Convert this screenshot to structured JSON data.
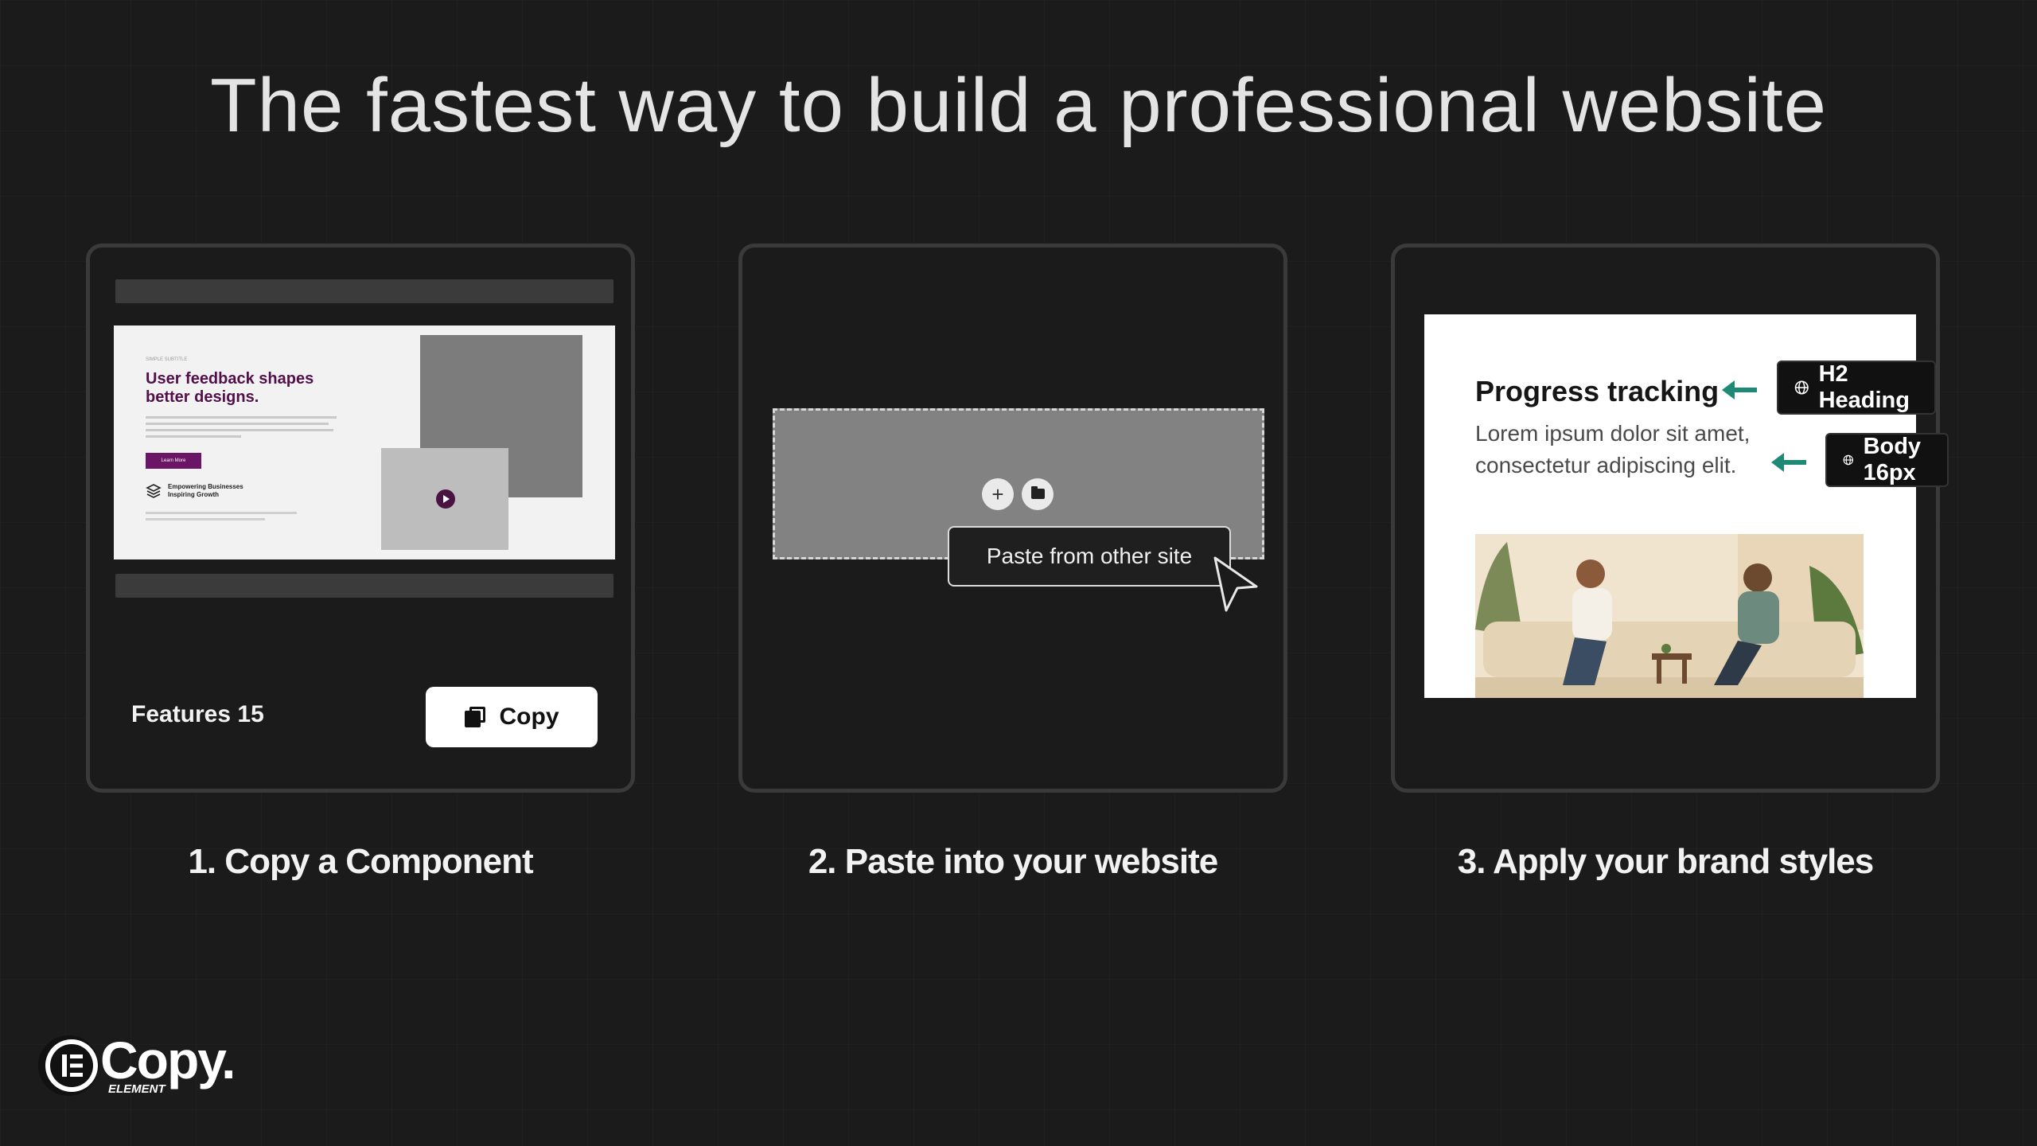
{
  "headline": "The fastest way to build a professional website",
  "steps": [
    {
      "label": "1. Copy a Component"
    },
    {
      "label": "2. Paste into your website"
    },
    {
      "label": "3. Apply your brand styles"
    }
  ],
  "card1": {
    "preview": {
      "kicker": "SIMPLE SUBTITLE",
      "title": "User feedback shapes better designs.",
      "button": "Learn More",
      "feature": "Empowering Businesses Inspiring Growth"
    },
    "component_name": "Features 15",
    "copy_label": "Copy"
  },
  "card2": {
    "add_icon": "plus-icon",
    "folder_icon": "folder-icon",
    "paste_label": "Paste from other site"
  },
  "card3": {
    "title": "Progress tracking",
    "body": "Lorem ipsum dolor sit amet, consectetur adipiscing elit.",
    "tags": [
      {
        "icon": "globe-icon",
        "label": "H2 Heading"
      },
      {
        "icon": "globe-icon",
        "label": "Body 16px"
      }
    ],
    "arrow_color": "#1e8a74"
  },
  "logo": {
    "word": "Copy.",
    "sub": "ELEMENT"
  }
}
